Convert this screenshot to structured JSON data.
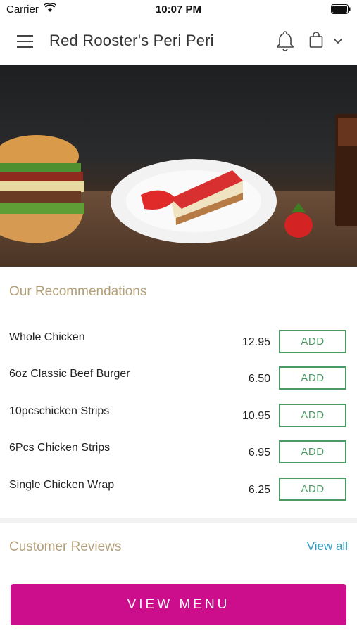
{
  "status_bar": {
    "carrier": "Carrier",
    "time": "10:07 PM"
  },
  "header": {
    "title": "Red Rooster's Peri Peri"
  },
  "hero": {
    "alt": ""
  },
  "recommendations": {
    "title": "Our Recommendations",
    "items": [
      {
        "name": "Whole Chicken",
        "price": "12.95",
        "button": "ADD"
      },
      {
        "name": "6oz Classic Beef Burger",
        "price": "6.50",
        "button": "ADD"
      },
      {
        "name": "10pcschicken Strips",
        "price": "10.95",
        "button": "ADD"
      },
      {
        "name": "6Pcs Chicken Strips",
        "price": "6.95",
        "button": "ADD"
      },
      {
        "name": "Single Chicken Wrap",
        "price": "6.25",
        "button": "ADD"
      }
    ]
  },
  "reviews": {
    "title": "Customer Reviews",
    "view_all": "View all"
  },
  "cta": {
    "label": "VIEW MENU"
  },
  "colors": {
    "accent": "#cc0e8c",
    "add_green": "#4c9a63",
    "section_title": "#b3a079",
    "link": "#2e9cc0"
  }
}
